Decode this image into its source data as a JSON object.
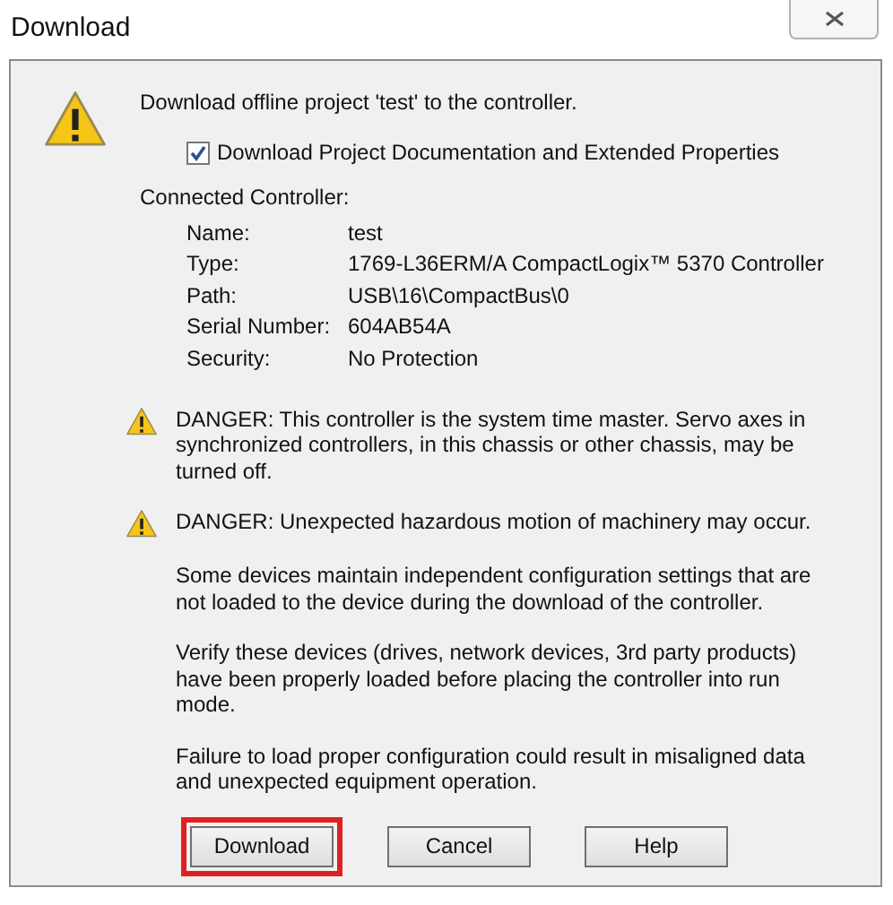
{
  "window": {
    "title": "Download"
  },
  "message": "Download offline project 'test' to the controller.",
  "checkbox": {
    "label": "Download Project Documentation and Extended Properties",
    "checked": true
  },
  "controller": {
    "heading": "Connected Controller:",
    "fields": [
      {
        "label": "Name:",
        "value": "test"
      },
      {
        "label": "Type:",
        "value": "1769-L36ERM/A CompactLogix™ 5370 Controller"
      },
      {
        "label": "Path:",
        "value": "USB\\16\\CompactBus\\0"
      },
      {
        "label": "Serial Number:",
        "value": "604AB54A"
      },
      {
        "label": "Security:",
        "value": "No Protection"
      }
    ]
  },
  "warnings": [
    {
      "kind": "danger",
      "text": "DANGER: This controller is the system time master.  Servo axes in synchronized controllers, in this chassis or other chassis, may be turned off."
    },
    {
      "kind": "danger",
      "text": "DANGER: Unexpected hazardous motion of machinery may occur."
    },
    {
      "kind": "note",
      "text": "Some devices maintain independent configuration settings that are not loaded to the device during the download of the controller."
    },
    {
      "kind": "note",
      "text": "Verify these devices (drives, network devices, 3rd party products) have been properly loaded before placing the controller into run mode."
    },
    {
      "kind": "note",
      "text": "Failure to load proper configuration could result in misaligned data and unexpected equipment operation."
    }
  ],
  "buttons": [
    {
      "label": "Download",
      "highlighted": true
    },
    {
      "label": "Cancel",
      "highlighted": false
    },
    {
      "label": "Help",
      "highlighted": false
    }
  ]
}
